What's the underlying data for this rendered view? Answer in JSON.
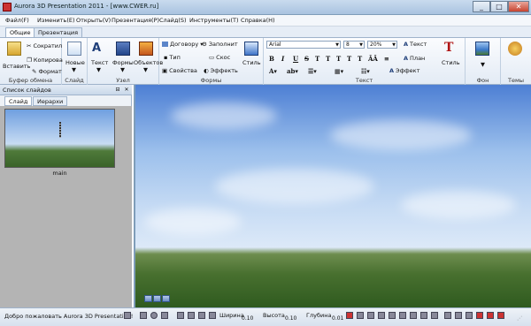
{
  "window": {
    "title": "Aurora 3D Presentation 2011 - [www.CWER.ru]",
    "minimize": "_",
    "maximize": "□",
    "close": "✕"
  },
  "menu": [
    "Файл(F)",
    "Изменить(E)",
    "Открыть(V)",
    "Презентация(P)",
    "Слайд(S)",
    "Инструменты(T)",
    "Справка(H)"
  ],
  "tabs": [
    "Общие",
    "Презентация"
  ],
  "ribbon": {
    "clipboard": {
      "paste": "Вставить",
      "cut": "Сократил",
      "copy": "Копирова",
      "format": "Формат",
      "label": "Буфер обмена"
    },
    "slide": {
      "new": "Новые",
      "label": "Слайд"
    },
    "node": {
      "text": "Текст",
      "shapes": "Формы",
      "objects": "Объектов",
      "label": "Узел"
    },
    "shapes": {
      "contract": "Договору",
      "fill": "Заполнит",
      "type": "Тип",
      "bevel": "Скос",
      "properties": "Свойства",
      "effect": "Эффекть",
      "style": "Стиль",
      "label": "Формы"
    },
    "text": {
      "font": "Arial",
      "size": "8",
      "zoom": "20%",
      "text_btn": "Текст",
      "plan": "План",
      "effect": "Эффект",
      "style": "Стиль",
      "label": "Текст"
    },
    "background": {
      "label": "Фон"
    },
    "themes": {
      "label": "Темы"
    }
  },
  "slide_list": {
    "title": "Список слайдов",
    "tabs": [
      "Слайд",
      "Иерархи"
    ],
    "slides": [
      {
        "name": "main"
      }
    ]
  },
  "status": {
    "message": "Добро пожаловать Aurora 3D Presentation!",
    "width_label": "Ширина",
    "width_value": "0.10",
    "height_label": "Высота",
    "height_value": "0.10",
    "depth_label": "Глубина",
    "depth_value": "0.01"
  }
}
